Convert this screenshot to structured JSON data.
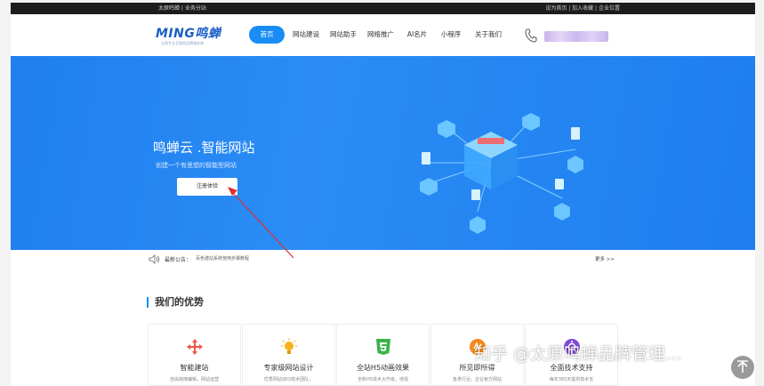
{
  "topbar": {
    "left": "太原鸣蝉 | 业务分站",
    "right": "设为首页 | 加入收藏 | 企业位置"
  },
  "logo": {
    "main": "MING鸣蝉",
    "sub": "太原专业互联网品牌服务商"
  },
  "nav": [
    {
      "label": "首页",
      "active": true
    },
    {
      "label": "网站建设"
    },
    {
      "label": "网站助手"
    },
    {
      "label": "网络推广"
    },
    {
      "label": "AI名片"
    },
    {
      "label": "小程序"
    },
    {
      "label": "关于我们"
    }
  ],
  "banner": {
    "title": "鸣蝉云 .智能网站",
    "subtitle": "创建一个有思想的智能型网站",
    "cta": "注册体验"
  },
  "notice": {
    "label": "最新公告：",
    "text": "百色建站系统使用步骤教程",
    "more": "更多 >>"
  },
  "advantages": {
    "title": "我们的优势",
    "cards": [
      {
        "title": "智能建站",
        "desc": "自由拖拽编辑，网站运营"
      },
      {
        "title": "专家级网站设计",
        "desc": "优秀网站SEO技术团队，"
      },
      {
        "title": "全站H5动画效果",
        "desc": "全新H5技术大升级，增强"
      },
      {
        "title": "所见即所得",
        "desc": "各类行业，企业官方网站"
      },
      {
        "title": "全面技术支持",
        "desc": "每年365天提供技术支"
      }
    ]
  },
  "watermark": "知乎 @太原鸣蝉品牌管理...",
  "colors": {
    "accent": "#1a8cf5",
    "banner": "#1f7ff0",
    "topbar": "#1c1c1c"
  }
}
